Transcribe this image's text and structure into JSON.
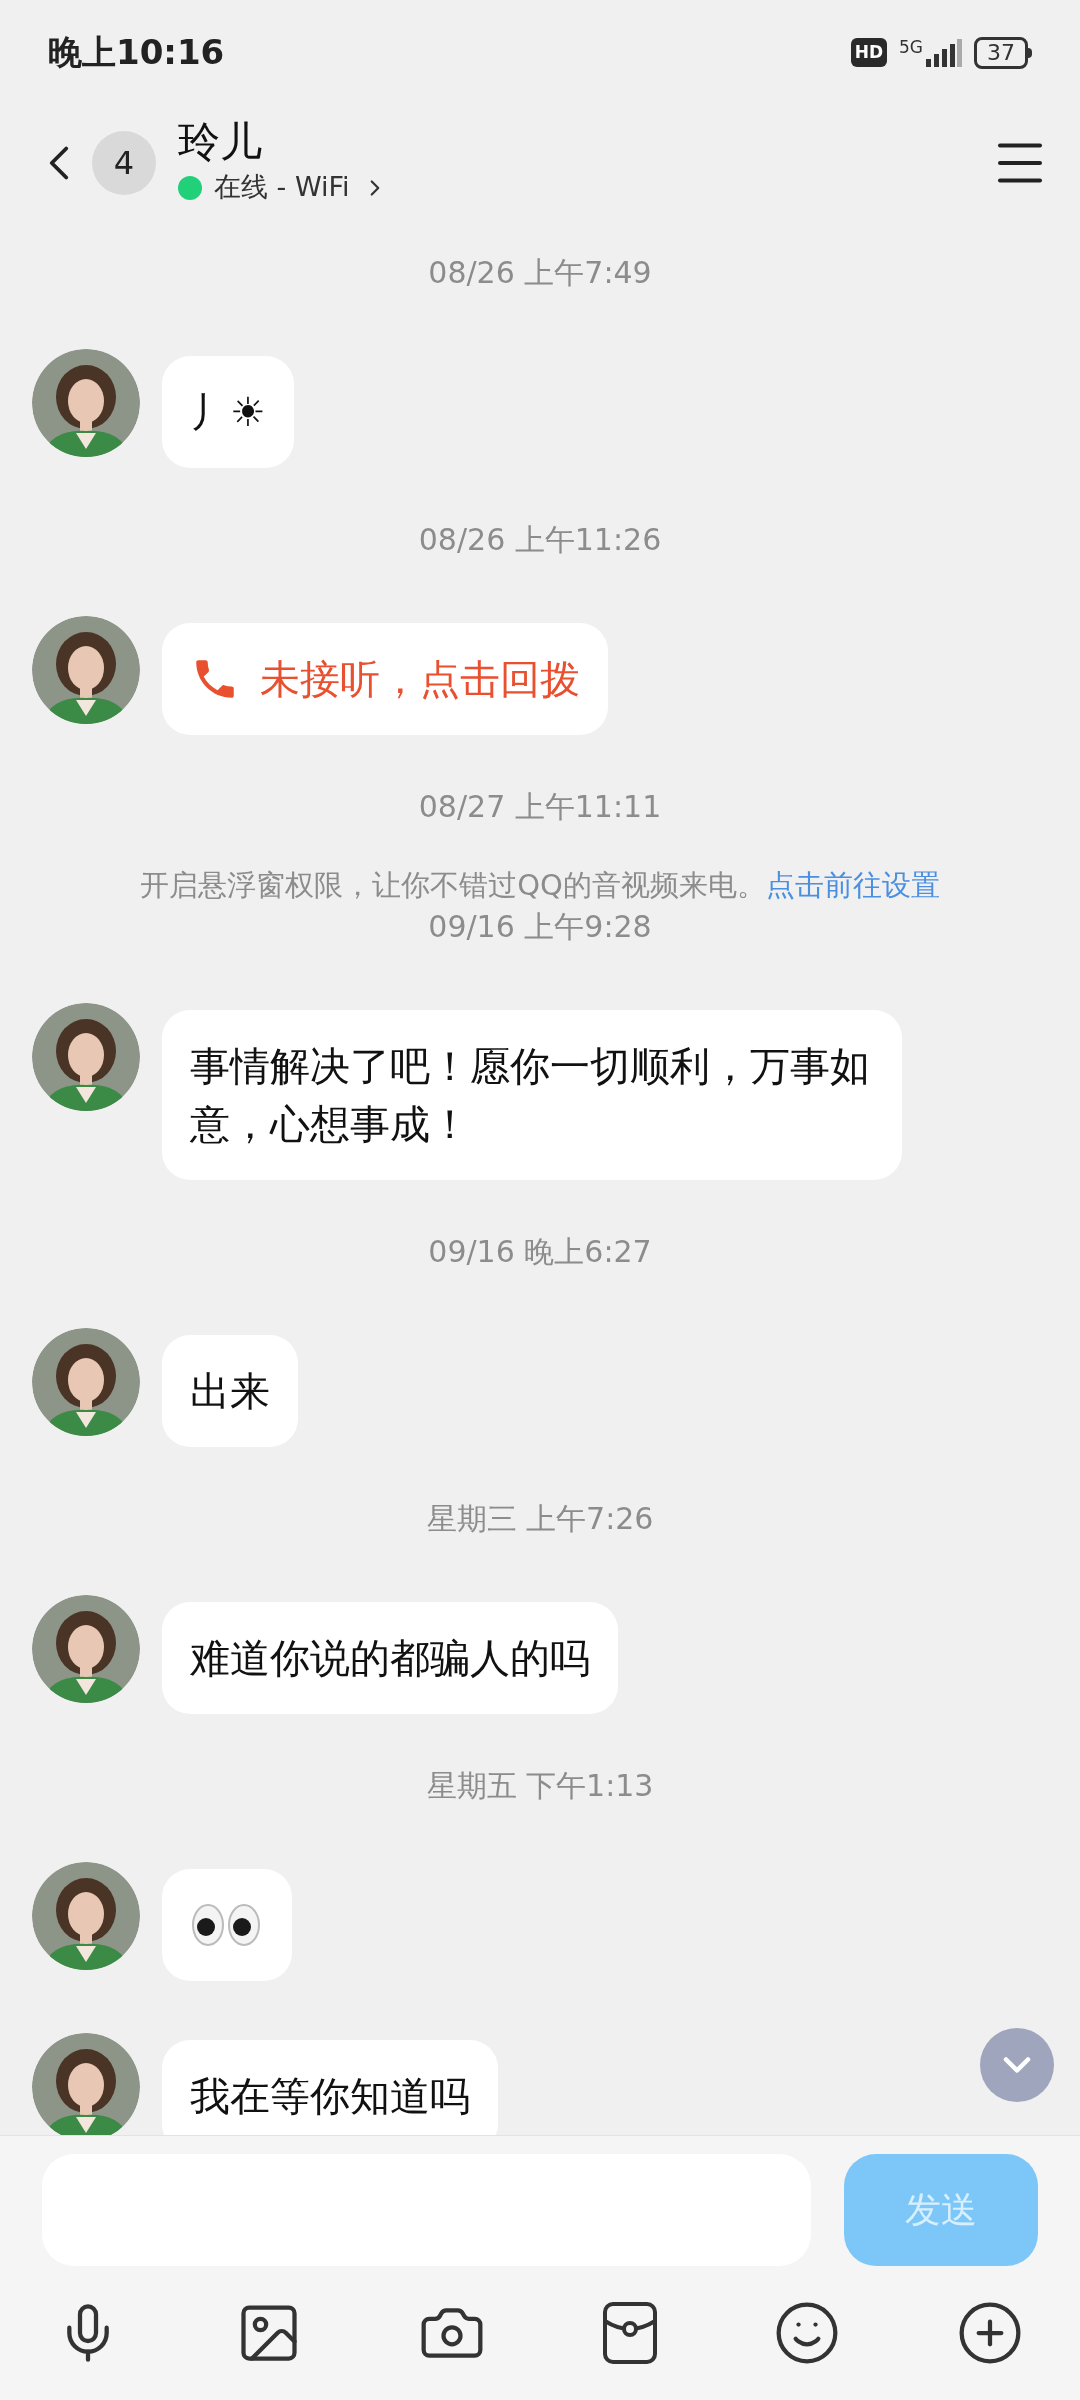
{
  "status_bar": {
    "time": "晚上10:16",
    "hd": "HD",
    "network": "5G",
    "battery": "37"
  },
  "header": {
    "unread": "4",
    "name": "玲儿",
    "presence": {
      "online": true,
      "text": "在线 - WiFi"
    }
  },
  "chat": [
    {
      "kind": "time",
      "text": "08/26 上午7:49"
    },
    {
      "kind": "text",
      "text": "丿☀"
    },
    {
      "kind": "time",
      "text": "08/26 上午11:26"
    },
    {
      "kind": "call",
      "text": "未接听，点击回拨"
    },
    {
      "kind": "time",
      "text": "08/27 上午11:11"
    },
    {
      "kind": "notice",
      "text": "开启悬浮窗权限，让你不错过QQ的音视频来电。",
      "link": "点击前往设置"
    },
    {
      "kind": "time",
      "text": "09/16 上午9:28"
    },
    {
      "kind": "text",
      "text": "事情解决了吧！愿你一切顺利，万事如意，心想事成！"
    },
    {
      "kind": "time",
      "text": "09/16 晚上6:27"
    },
    {
      "kind": "text",
      "text": "出来"
    },
    {
      "kind": "time",
      "text": "星期三 上午7:26"
    },
    {
      "kind": "text",
      "text": "难道你说的都骗人的吗"
    },
    {
      "kind": "time",
      "text": "星期五 下午1:13"
    },
    {
      "kind": "eyes"
    },
    {
      "kind": "text",
      "text": "我在等你知道吗"
    }
  ],
  "composer": {
    "send": "发送",
    "disabled": true
  }
}
